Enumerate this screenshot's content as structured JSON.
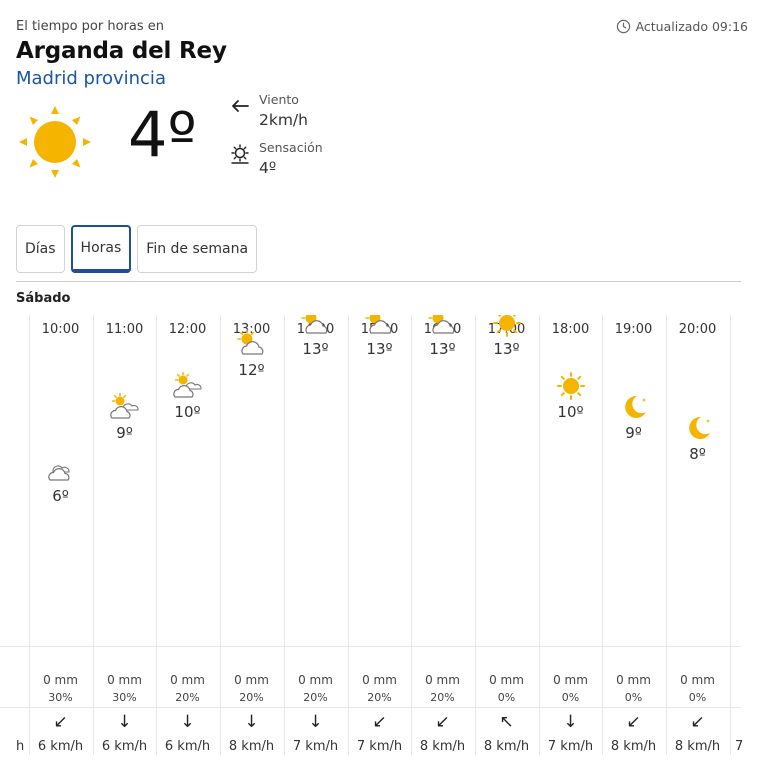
{
  "header": {
    "kicker": "El tiempo por horas en",
    "updated": "Actualizado 09:16",
    "city": "Arganda del Rey",
    "province": "Madrid provincia"
  },
  "current": {
    "temp": "4º",
    "icon": "sun-icon",
    "wind_label": "Viento",
    "wind_value": "2km/h",
    "feel_label": "Sensación",
    "feel_value": "4º"
  },
  "tabs": [
    {
      "label": "Días",
      "active": false
    },
    {
      "label": "Horas",
      "active": true
    },
    {
      "label": "Fin de semana",
      "active": false
    }
  ],
  "day_label": "Sábado",
  "edge": {
    "left_speed": "h",
    "right_speed": "7"
  },
  "hours": [
    {
      "time": "10:00",
      "temp": "6º",
      "temp_value": 6,
      "icon": "cloudy",
      "rain": "0 mm",
      "prob": "30%",
      "arrow": "↙",
      "speed": "6 km/h"
    },
    {
      "time": "11:00",
      "temp": "9º",
      "temp_value": 9,
      "icon": "partly-cloudy",
      "rain": "0 mm",
      "prob": "30%",
      "arrow": "↓",
      "speed": "6 km/h"
    },
    {
      "time": "12:00",
      "temp": "10º",
      "temp_value": 10,
      "icon": "partly-cloudy",
      "rain": "0 mm",
      "prob": "20%",
      "arrow": "↓",
      "speed": "6 km/h"
    },
    {
      "time": "13:00",
      "temp": "12º",
      "temp_value": 12,
      "icon": "sun-cloud",
      "rain": "0 mm",
      "prob": "20%",
      "arrow": "↓",
      "speed": "8 km/h"
    },
    {
      "time": "14:00",
      "temp": "13º",
      "temp_value": 13,
      "icon": "sun-cloud",
      "rain": "0 mm",
      "prob": "20%",
      "arrow": "↓",
      "speed": "7 km/h"
    },
    {
      "time": "15:00",
      "temp": "13º",
      "temp_value": 13,
      "icon": "sun-cloud",
      "rain": "0 mm",
      "prob": "20%",
      "arrow": "↙",
      "speed": "7 km/h"
    },
    {
      "time": "16:00",
      "temp": "13º",
      "temp_value": 13,
      "icon": "sun-cloud",
      "rain": "0 mm",
      "prob": "20%",
      "arrow": "↙",
      "speed": "8 km/h"
    },
    {
      "time": "17:00",
      "temp": "13º",
      "temp_value": 13,
      "icon": "sun",
      "rain": "0 mm",
      "prob": "0%",
      "arrow": "↖",
      "speed": "8 km/h"
    },
    {
      "time": "18:00",
      "temp": "10º",
      "temp_value": 10,
      "icon": "sun",
      "rain": "0 mm",
      "prob": "0%",
      "arrow": "↓",
      "speed": "7 km/h"
    },
    {
      "time": "19:00",
      "temp": "9º",
      "temp_value": 9,
      "icon": "moon",
      "rain": "0 mm",
      "prob": "0%",
      "arrow": "↙",
      "speed": "8 km/h"
    },
    {
      "time": "20:00",
      "temp": "8º",
      "temp_value": 8,
      "icon": "moon",
      "rain": "0 mm",
      "prob": "0%",
      "arrow": "↙",
      "speed": "8 km/h"
    }
  ],
  "colors": {
    "sun": "#f5b400",
    "accent": "#1f4e9c",
    "province": "#1a55a6"
  }
}
